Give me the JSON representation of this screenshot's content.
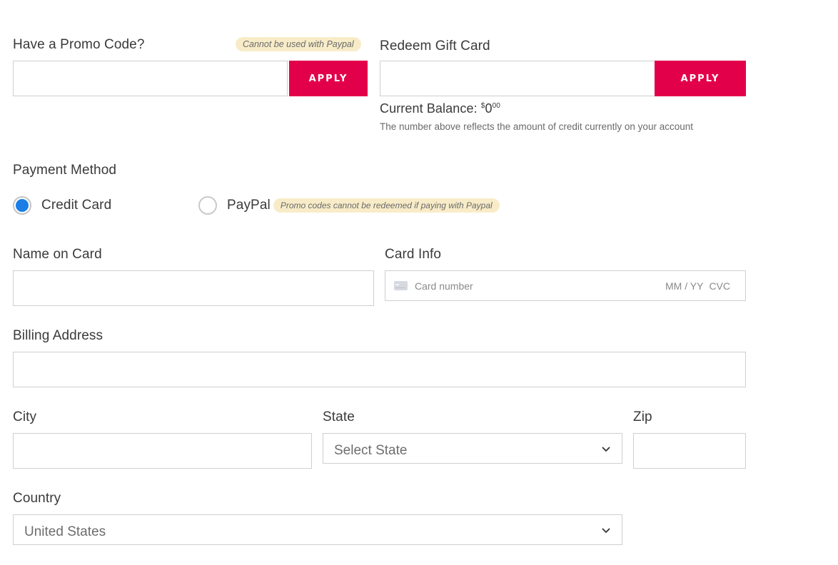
{
  "promo": {
    "label": "Have a Promo Code?",
    "badge": "Cannot be used with Paypal",
    "input_value": "",
    "apply_label": "APPLY"
  },
  "gift_card": {
    "label": "Redeem Gift Card",
    "input_value": "",
    "apply_label": "APPLY",
    "balance_label": "Current Balance:",
    "balance_currency": "$",
    "balance_whole": "0",
    "balance_cents": "00",
    "note": "The number above reflects the amount of credit currently on your account"
  },
  "payment_method": {
    "label": "Payment Method",
    "options": [
      {
        "label": "Credit Card",
        "selected": true
      },
      {
        "label": "PayPal",
        "selected": false
      }
    ],
    "paypal_note": "Promo codes cannot be redeemed if paying with Paypal"
  },
  "name_on_card": {
    "label": "Name on Card",
    "value": ""
  },
  "card_info": {
    "label": "Card Info",
    "card_number_placeholder": "Card number",
    "expiry_placeholder": "MM / YY",
    "cvc_placeholder": "CVC",
    "icon": "credit-card-icon"
  },
  "billing_address": {
    "label": "Billing Address",
    "value": ""
  },
  "city": {
    "label": "City",
    "value": ""
  },
  "state": {
    "label": "State",
    "selected": "Select State"
  },
  "zip": {
    "label": "Zip",
    "value": ""
  },
  "country": {
    "label": "Country",
    "selected": "United States"
  },
  "colors": {
    "accent": "#e2004a",
    "radio_selected": "#1a7ee6",
    "badge_bg": "#f8ecc8"
  }
}
